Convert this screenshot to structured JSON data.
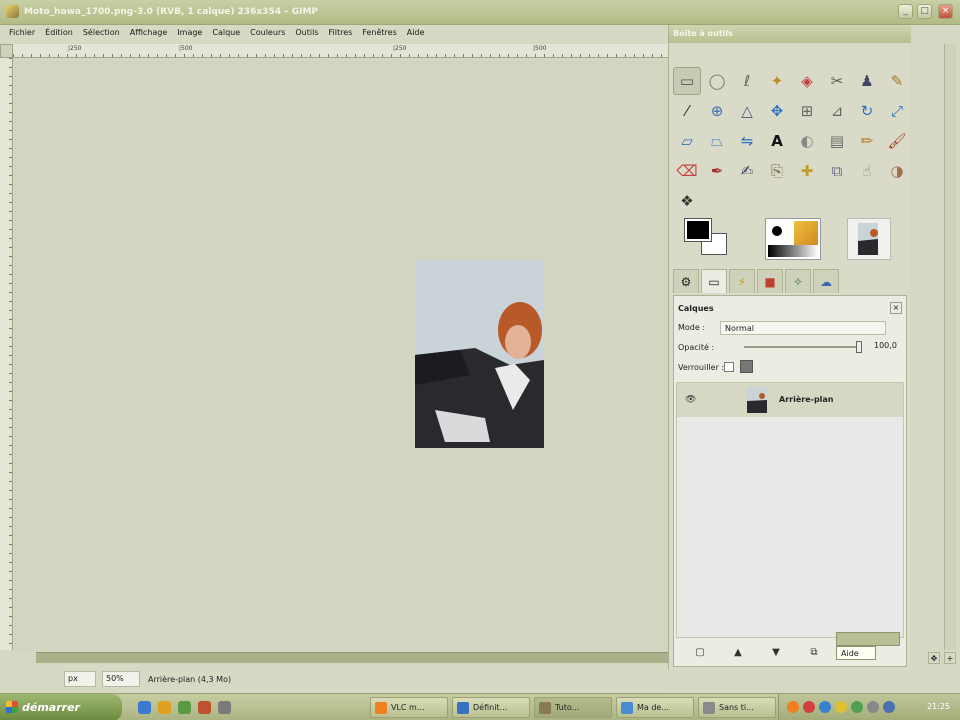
{
  "window": {
    "title": "Moto_hawa_1700.png-3.0 (RVB, 1 calque) 236x354 – GIMP"
  },
  "menu": [
    "Fichier",
    "Édition",
    "Sélection",
    "Affichage",
    "Image",
    "Calque",
    "Couleurs",
    "Outils",
    "Filtres",
    "Fenêtres",
    "Aide"
  ],
  "ruler_ticks": [
    "|250",
    "|500",
    "|250",
    "|500"
  ],
  "dock": {
    "title": "Boîte à outils",
    "tools": [
      {
        "icon": "rect-select-icon",
        "glyph": "▭"
      },
      {
        "icon": "ellipse-select-icon",
        "glyph": "◯"
      },
      {
        "icon": "free-select-icon",
        "glyph": "ℓ"
      },
      {
        "icon": "fuzzy-select-icon",
        "glyph": "✦"
      },
      {
        "icon": "color-select-icon",
        "glyph": "◈"
      },
      {
        "icon": "scissors-icon",
        "glyph": "✂"
      },
      {
        "icon": "foreground-select-icon",
        "glyph": "♟"
      },
      {
        "icon": "paths-icon",
        "glyph": "✎"
      },
      {
        "icon": "color-picker-icon",
        "glyph": "⁄"
      },
      {
        "icon": "zoom-icon",
        "glyph": "⊕"
      },
      {
        "icon": "measure-icon",
        "glyph": "△"
      },
      {
        "icon": "move-icon",
        "glyph": "✥"
      },
      {
        "icon": "align-icon",
        "glyph": "⊞"
      },
      {
        "icon": "crop-icon",
        "glyph": "⊿"
      },
      {
        "icon": "rotate-icon",
        "glyph": "↻"
      },
      {
        "icon": "scale-icon",
        "glyph": "⤢"
      },
      {
        "icon": "shear-icon",
        "glyph": "▱"
      },
      {
        "icon": "perspective-icon",
        "glyph": "⏢"
      },
      {
        "icon": "flip-icon",
        "glyph": "⇋"
      },
      {
        "icon": "text-icon",
        "glyph": "A"
      },
      {
        "icon": "bucket-fill-icon",
        "glyph": "◐"
      },
      {
        "icon": "blend-icon",
        "glyph": "▤"
      },
      {
        "icon": "pencil-icon",
        "glyph": "✏"
      },
      {
        "icon": "paintbrush-icon",
        "glyph": "🖌"
      },
      {
        "icon": "eraser-icon",
        "glyph": "⌫"
      },
      {
        "icon": "airbrush-icon",
        "glyph": "✒"
      },
      {
        "icon": "ink-icon",
        "glyph": "✍"
      },
      {
        "icon": "clone-icon",
        "glyph": "⎘"
      },
      {
        "icon": "heal-icon",
        "glyph": "✚"
      },
      {
        "icon": "perspective-clone-icon",
        "glyph": "⧉"
      },
      {
        "icon": "smudge-icon",
        "glyph": "☝"
      },
      {
        "icon": "dodge-burn-icon",
        "glyph": "◑"
      },
      {
        "icon": "color-tool-icon",
        "glyph": "❖"
      }
    ],
    "tabs": [
      "tool-options-icon",
      "device-status-icon",
      "undo-history-icon",
      "images-icon",
      "brushes-icon",
      "patterns-icon"
    ]
  },
  "layers": {
    "title": "Calques",
    "mode_label": "Mode :",
    "mode_value": "Normal",
    "opacity_label": "Opacité :",
    "opacity_value": "100,0",
    "lock_label": "Verrouiller :",
    "items": [
      {
        "name": "Arrière-plan",
        "visible_mark": "👁"
      }
    ],
    "bottom_buttons": [
      "new-layer-icon",
      "raise-layer-icon",
      "lower-layer-icon",
      "duplicate-layer-icon"
    ],
    "tooltip_text": "Aide"
  },
  "status": {
    "unit": "px",
    "zoom": "50%",
    "text": "Arrière-plan (4,3 Mo)"
  },
  "taskbar": {
    "start_label": "démarrer",
    "tasks": [
      "VLC m...",
      "Définit...",
      "Tuto...",
      "Ma de...",
      "Sans ti..."
    ],
    "clock": "21:25"
  }
}
